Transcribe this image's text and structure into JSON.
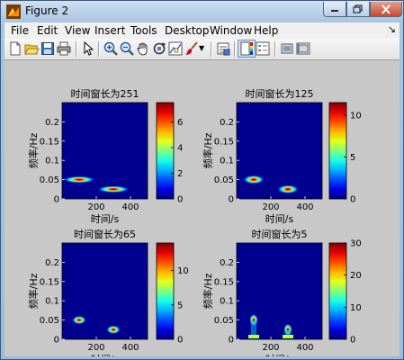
{
  "window": {
    "title": "Figure 2"
  },
  "menu": [
    "File",
    "Edit",
    "View",
    "Insert",
    "Tools",
    "Desktop",
    "Window",
    "Help"
  ],
  "menu_arrow": "↘",
  "toolbar": [
    "new-figure",
    "open-file",
    "save-figure",
    "print-figure",
    "edit-plot",
    "zoom-in",
    "zoom-out",
    "pan",
    "rotate-3d",
    "data-cursor",
    "brush",
    "brush-menu",
    "link-plot",
    "insert-colorbar",
    "insert-legend",
    "hide-plot-tools",
    "show-plot-tools"
  ],
  "colors": {
    "axes_bg": "#00008f",
    "figure_bg": "#c8c8c8"
  },
  "subplots": [
    {
      "title": "时间窗长为251",
      "xlabel": "时间/s",
      "ylabel": "频率/Hz",
      "colorbar_ticks": [
        "0",
        "2",
        "4",
        "6"
      ],
      "colorbar_max": 7.5
    },
    {
      "title": "时间窗长为125",
      "xlabel": "时间/s",
      "ylabel": "频率/Hz",
      "colorbar_ticks": [
        "0",
        "5",
        "10"
      ],
      "colorbar_max": 11.5
    },
    {
      "title": "时间窗长为65",
      "xlabel": "时间/s",
      "ylabel": "频率/Hz",
      "colorbar_ticks": [
        "0",
        "5",
        "10"
      ],
      "colorbar_max": 14
    },
    {
      "title": "时间窗长为5",
      "xlabel": "时间/s",
      "ylabel": "频率/Hz",
      "colorbar_ticks": [
        "0",
        "10",
        "20",
        "30"
      ],
      "colorbar_max": 30
    }
  ],
  "chart_data": [
    {
      "type": "heatmap",
      "title": "时间窗长为251",
      "xlabel": "时间/s",
      "ylabel": "频率/Hz",
      "xticks": [
        "200",
        "400"
      ],
      "yticks": [
        "0",
        "0.05",
        "0.1",
        "0.15",
        "0.2"
      ],
      "xlim": [
        0,
        500
      ],
      "ylim": [
        0,
        0.25
      ],
      "clim": [
        0,
        7.5
      ],
      "colorbar_ticks": [
        "0",
        "2",
        "4",
        "6"
      ],
      "blobs": [
        {
          "t": 100,
          "f": 0.05,
          "peak": 7.5
        },
        {
          "t": 300,
          "f": 0.025,
          "peak": 7.5
        }
      ]
    },
    {
      "type": "heatmap",
      "title": "时间窗长为125",
      "xlabel": "时间/s",
      "ylabel": "频率/Hz",
      "xticks": [
        "200",
        "400"
      ],
      "yticks": [
        "0",
        "0.05",
        "0.1",
        "0.15",
        "0.2"
      ],
      "xlim": [
        0,
        500
      ],
      "ylim": [
        0,
        0.25
      ],
      "clim": [
        0,
        11.5
      ],
      "colorbar_ticks": [
        "0",
        "5",
        "10"
      ],
      "blobs": [
        {
          "t": 100,
          "f": 0.05,
          "peak": 11.5
        },
        {
          "t": 300,
          "f": 0.025,
          "peak": 11.5
        }
      ]
    },
    {
      "type": "heatmap",
      "title": "时间窗长为65",
      "xlabel": "时间/s",
      "ylabel": "频率/Hz",
      "xticks": [
        "200",
        "400"
      ],
      "yticks": [
        "0",
        "0.05",
        "0.1",
        "0.15",
        "0.2"
      ],
      "xlim": [
        0,
        500
      ],
      "ylim": [
        0,
        0.25
      ],
      "clim": [
        0,
        14
      ],
      "colorbar_ticks": [
        "0",
        "5",
        "10"
      ],
      "blobs": [
        {
          "t": 100,
          "f": 0.05,
          "peak": 14
        },
        {
          "t": 300,
          "f": 0.025,
          "peak": 14
        }
      ]
    },
    {
      "type": "heatmap",
      "title": "时间窗长为5",
      "xlabel": "时间/s",
      "ylabel": "频率/Hz",
      "xticks": [
        "200",
        "400"
      ],
      "yticks": [
        "0",
        "0.05",
        "0.1",
        "0.15",
        "0.2"
      ],
      "xlim": [
        0,
        500
      ],
      "ylim": [
        0,
        0.25
      ],
      "clim": [
        0,
        30
      ],
      "colorbar_ticks": [
        "0",
        "10",
        "20",
        "30"
      ],
      "blobs": [
        {
          "t": 100,
          "f": 0.05,
          "peak": 30
        },
        {
          "t": 300,
          "f": 0.025,
          "peak": 30
        }
      ]
    }
  ]
}
